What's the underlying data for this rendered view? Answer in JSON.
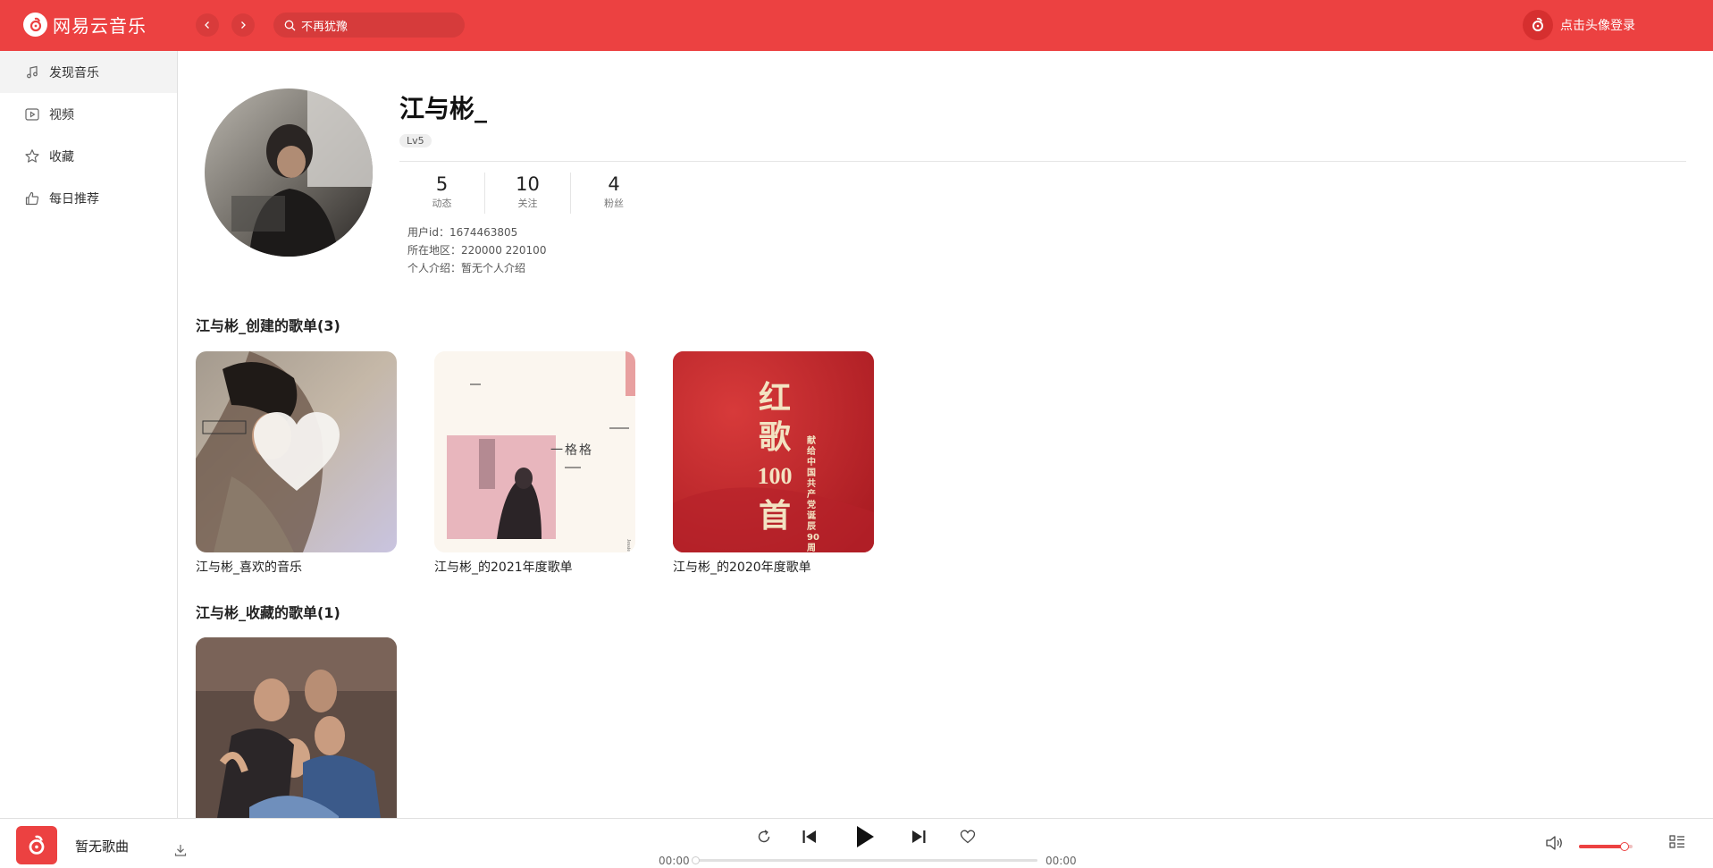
{
  "header": {
    "app_name": "网易云音乐",
    "search": {
      "value": "不再犹豫",
      "placeholder": "不再犹豫"
    },
    "login_text": "点击头像登录"
  },
  "sidebar": {
    "items": [
      {
        "label": "发现音乐",
        "icon": "music-note-icon",
        "active": true
      },
      {
        "label": "视频",
        "icon": "video-icon",
        "active": false
      },
      {
        "label": "收藏",
        "icon": "star-icon",
        "active": false
      },
      {
        "label": "每日推荐",
        "icon": "thumbs-up-icon",
        "active": false
      }
    ]
  },
  "profile": {
    "name": "江与彬_",
    "level": "Lv5",
    "stats": [
      {
        "num": "5",
        "label": "动态"
      },
      {
        "num": "10",
        "label": "关注"
      },
      {
        "num": "4",
        "label": "粉丝"
      }
    ],
    "user_id_label": "用户id：",
    "user_id": "1674463805",
    "region_label": "所在地区：",
    "region": "220000 220100",
    "bio_label": "个人介绍：",
    "bio": "暂无个人介绍"
  },
  "created": {
    "title": "江与彬_创建的歌单(3)",
    "playlists": [
      {
        "title": "江与彬_喜欢的音乐"
      },
      {
        "title": "江与彬_的2021年度歌单"
      },
      {
        "title": "江与彬_的2020年度歌单"
      }
    ]
  },
  "collected": {
    "title": "江与彬_收藏的歌单(1)"
  },
  "cover_text": {
    "red_big": [
      "红",
      "歌",
      "100",
      "首"
    ],
    "red_side": "献给中国共产党诞辰90周年",
    "book_name": "一格格"
  },
  "player": {
    "song": "暂无歌曲",
    "current_time": "00:00",
    "total_time": "00:00",
    "progress": 0,
    "volume": 0.85
  },
  "colors": {
    "accent": "#ec4141"
  }
}
